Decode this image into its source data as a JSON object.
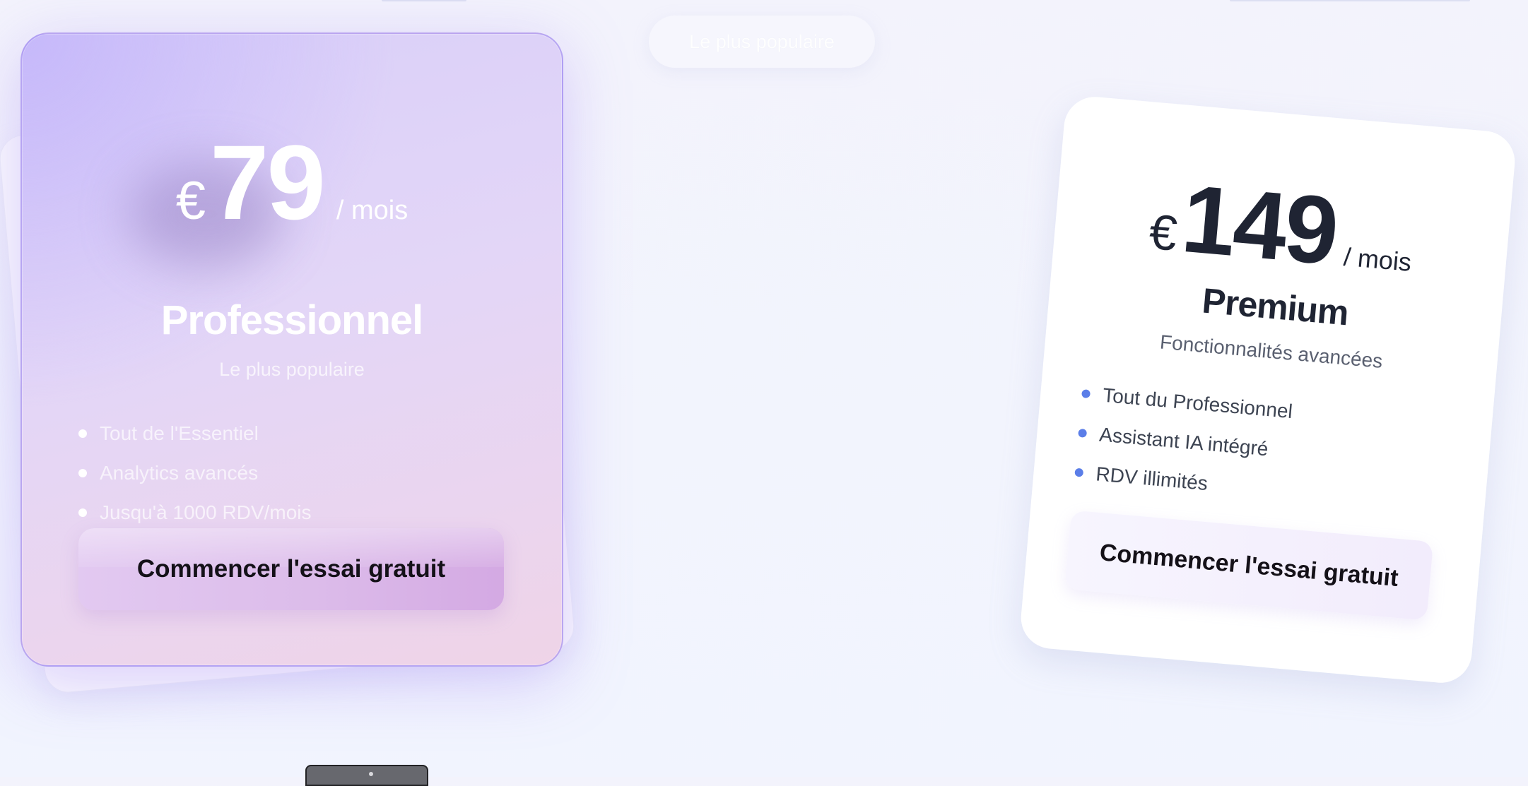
{
  "popular_pill": {
    "label": "Le plus populaire"
  },
  "plans": {
    "professional": {
      "currency": "€",
      "amount": "79",
      "period": "/ mois",
      "name": "Professionnel",
      "subtitle": "Le plus populaire",
      "features": [
        "Tout de l'Essentiel",
        "Analytics avancés",
        "Jusqu'à 1000 RDV/mois"
      ],
      "cta": "Commencer l'essai gratuit"
    },
    "premium": {
      "currency": "€",
      "amount": "149",
      "period": "/ mois",
      "name": "Premium",
      "subtitle": "Fonctionnalités avancées",
      "features": [
        "Tout du Professionnel",
        "Assistant IA intégré",
        "RDV illimités"
      ],
      "cta": "Commencer l'essai gratuit"
    }
  },
  "colors": {
    "accent_purple": "#a896f0",
    "premium_bullet": "#5b7ee8",
    "text_dark": "#1f2433"
  }
}
